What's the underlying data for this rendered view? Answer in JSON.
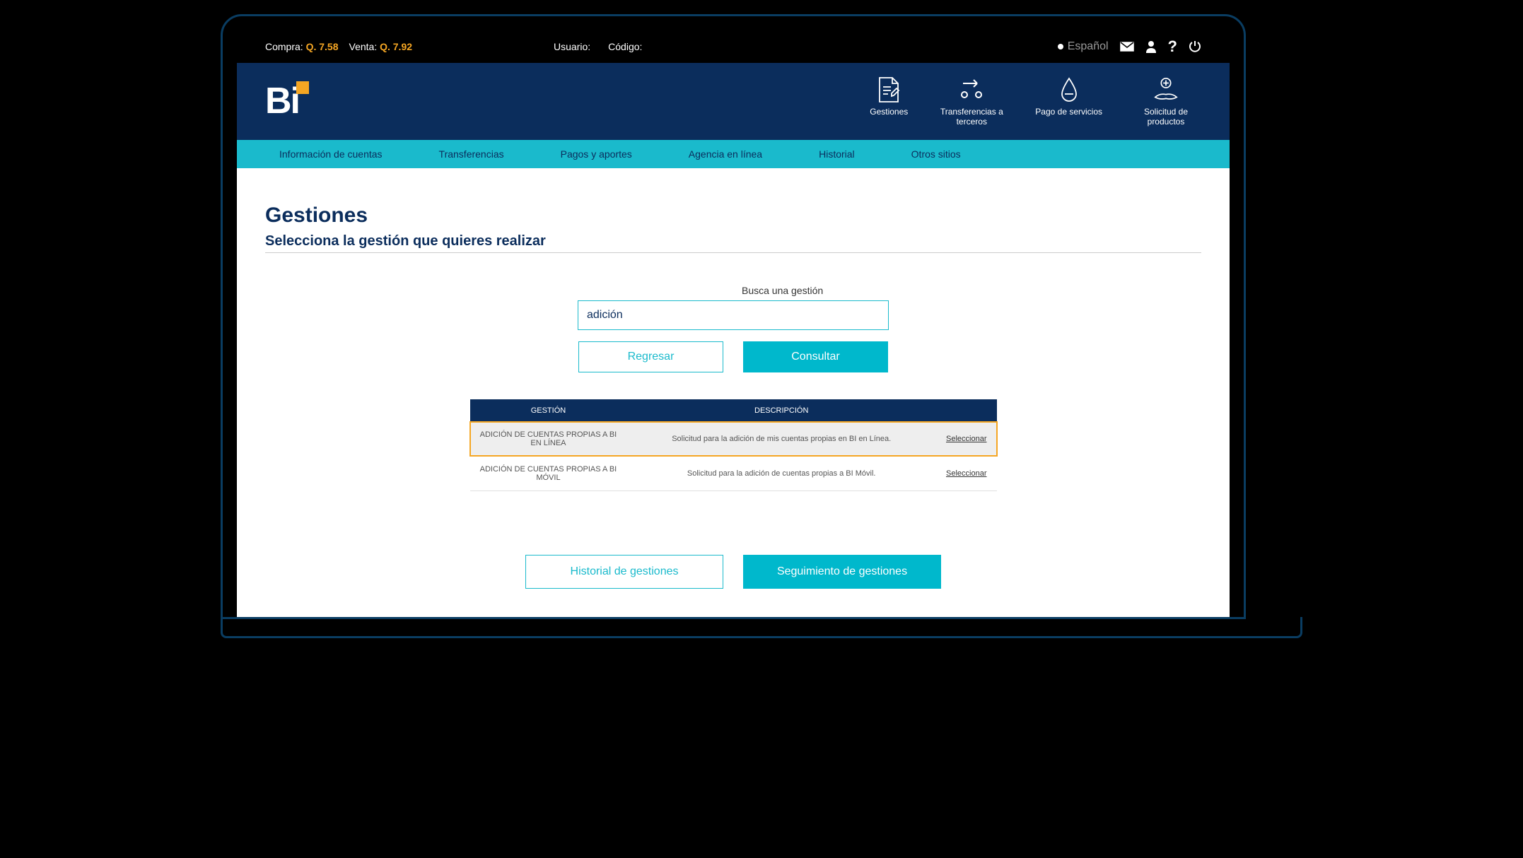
{
  "topbar": {
    "compra_label": "Compra:",
    "compra_value": "Q. 7.58",
    "venta_label": "Venta:",
    "venta_value": "Q. 7.92",
    "usuario_label": "Usuario:",
    "codigo_label": "Código:",
    "language": "Español"
  },
  "header_actions": [
    {
      "label": "Gestiones"
    },
    {
      "label": "Transferencias a terceros"
    },
    {
      "label": "Pago de servicios"
    },
    {
      "label": "Solicitud de productos"
    }
  ],
  "navbar": [
    "Información de cuentas",
    "Transferencias",
    "Pagos y aportes",
    "Agencia en línea",
    "Historial",
    "Otros sitios"
  ],
  "page": {
    "title": "Gestiones",
    "subtitle": "Selecciona la gestión que quieres realizar",
    "search_label": "Busca una gestión",
    "search_value": "adición",
    "btn_back": "Regresar",
    "btn_query": "Consultar"
  },
  "table": {
    "headers": {
      "gestion": "GESTIÓN",
      "descripcion": "DESCRIPCIÓN",
      "action": ""
    },
    "rows": [
      {
        "gestion": "ADICIÓN DE CUENTAS PROPIAS A BI EN LÍNEA",
        "descripcion": "Solicitud para la adición de mis cuentas propias en BI en Línea.",
        "action": "Seleccionar",
        "highlighted": true
      },
      {
        "gestion": "ADICIÓN DE CUENTAS PROPIAS A BI MÓVIL",
        "descripcion": "Solicitud para la adición de cuentas propias a BI Móvil.",
        "action": "Seleccionar",
        "highlighted": false
      }
    ]
  },
  "bottom": {
    "history": "Historial de gestiones",
    "followup": "Seguimiento de gestiones"
  }
}
